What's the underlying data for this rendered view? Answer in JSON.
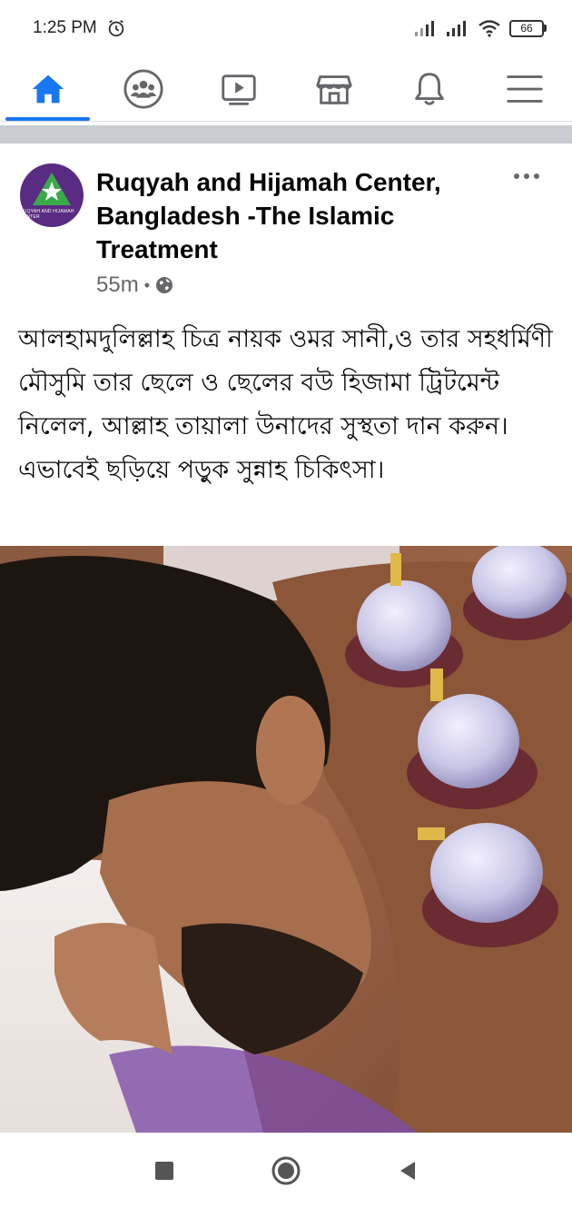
{
  "status_bar": {
    "time": "1:25 PM",
    "battery": "66",
    "icons": [
      "alarm-icon",
      "signal-icon",
      "signal-icon",
      "wifi-icon",
      "battery-icon"
    ]
  },
  "nav": {
    "items": [
      {
        "name": "home",
        "icon": "home-icon",
        "active": true
      },
      {
        "name": "groups",
        "icon": "groups-icon",
        "active": false
      },
      {
        "name": "watch",
        "icon": "video-icon",
        "active": false
      },
      {
        "name": "marketplace",
        "icon": "store-icon",
        "active": false
      },
      {
        "name": "notifications",
        "icon": "bell-icon",
        "active": false
      },
      {
        "name": "menu",
        "icon": "hamburger-icon",
        "active": false
      }
    ],
    "accent": "#1877f2"
  },
  "post": {
    "page_name": "Ruqyah and Hijamah Center, Bangladesh -The Islamic Treatment",
    "time_ago": "55m",
    "separator": "•",
    "audience_icon": "globe-icon",
    "text_lines": [
      "আলহামদুলিল্লাহ চিত্র নায়ক ওমর সানী,ও তার সহধর্মিণী মৌসুমি তার ছেলে ও ছেলের বউ হিজামা ট্রিটমেন্ট নিলেল, আল্লাহ তায়ালা উনাদের সুস্থতা দান করুন।",
      "এভাবেই ছড়িয়ে পড়ুক সুন্নাহ চিকিৎসা।"
    ],
    "avatar_logo_text": "RUQYAH AND HIJAMAH CENTER"
  },
  "android_nav": {
    "icons": [
      "recents-square-icon",
      "home-circle-icon",
      "back-triangle-icon"
    ]
  }
}
